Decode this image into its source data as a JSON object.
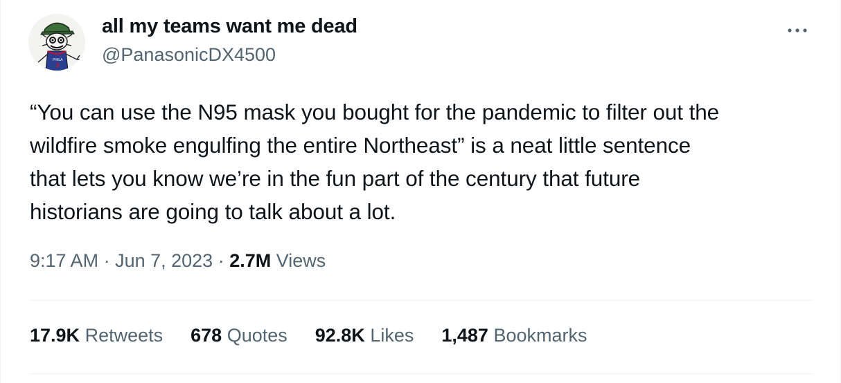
{
  "author": {
    "display_name": "all my teams want me dead",
    "handle": "@PanasonicDX4500",
    "avatar_icon": "avatar-image",
    "jersey_text": "PHILA",
    "jersey_number": "3"
  },
  "more_icon": "more-horizontal-icon",
  "tweet": {
    "text": "“You can use the N95 mask you bought for the pandemic to filter out the\nwildfire smoke engulfing the entire Northeast” is a neat little sentence\nthat lets you know we’re in the fun part of the century that future\nhistorians are going to talk about a lot."
  },
  "meta": {
    "time": "9:17 AM",
    "separator1": " · ",
    "date": "Jun 7, 2023",
    "separator2": " · ",
    "views_count": "2.7M",
    "views_label": " Views"
  },
  "stats": [
    {
      "count": "17.9K",
      "label": " Retweets"
    },
    {
      "count": "678",
      "label": " Quotes"
    },
    {
      "count": "92.8K",
      "label": " Likes"
    },
    {
      "count": "1,487",
      "label": " Bookmarks"
    }
  ],
  "colors": {
    "text_primary": "#0f1419",
    "text_secondary": "#536471",
    "divider": "#eff3f4",
    "jersey_blue": "#2a3f8f",
    "jersey_red": "#c8102e",
    "cap_green": "#3c6e3a"
  }
}
